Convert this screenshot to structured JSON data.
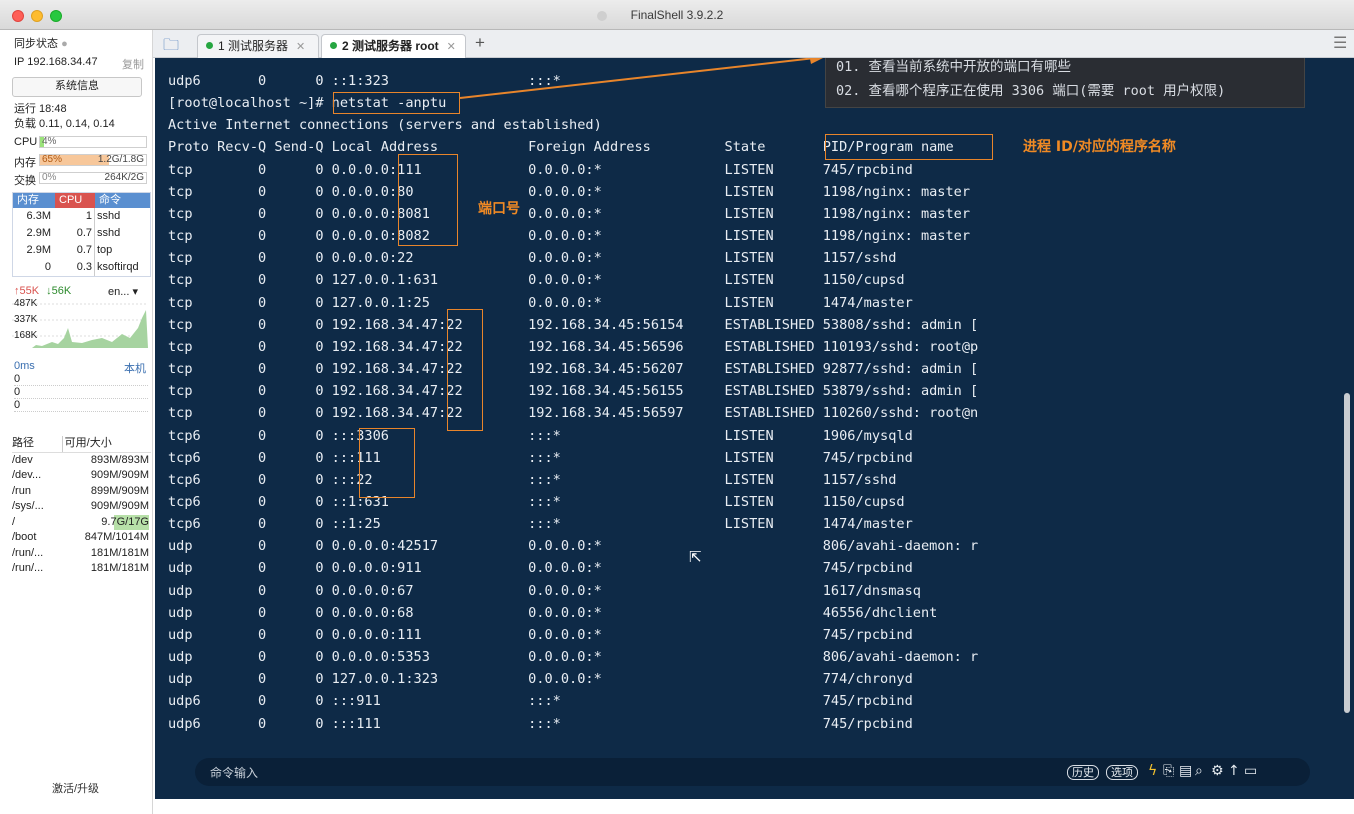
{
  "window": {
    "title": "FinalShell 3.9.2.2"
  },
  "sidebar": {
    "sync_label": "同步状态",
    "ip_label": "IP 192.168.34.47",
    "copy_label": "复制",
    "sysinfo_button": "系统信息",
    "uptime": "运行 18:48",
    "load": "负载 0.11, 0.14, 0.14",
    "cpu": {
      "label": "CPU",
      "value": "4%",
      "fraction": 0.04
    },
    "mem": {
      "label": "内存",
      "percent": "65%",
      "value": "1.2G/1.8G",
      "fraction": 0.65
    },
    "swap": {
      "label": "交换",
      "percent": "0%",
      "value": "264K/2G",
      "fraction": 0.0
    },
    "proc_headers": [
      "内存",
      "CPU",
      "命令"
    ],
    "processes": [
      {
        "mem": "6.3M",
        "cpu": "1",
        "cmd": "sshd"
      },
      {
        "mem": "2.9M",
        "cpu": "0.7",
        "cmd": "sshd"
      },
      {
        "mem": "2.9M",
        "cpu": "0.7",
        "cmd": "top"
      },
      {
        "mem": "0",
        "cpu": "0.3",
        "cmd": "ksoftirqd"
      }
    ],
    "net": {
      "up": "55K",
      "down": "56K",
      "iface": "en...",
      "y_labels": [
        "487K",
        "337K",
        "168K"
      ]
    },
    "latency": {
      "label": "0ms",
      "host": "本机",
      "values": [
        "0",
        "0",
        "0"
      ]
    },
    "disk_headers": [
      "路径",
      "可用/大小"
    ],
    "disks": [
      {
        "path": "/dev",
        "size": "893M/893M"
      },
      {
        "path": "/dev...",
        "size": "909M/909M"
      },
      {
        "path": "/run",
        "size": "899M/909M"
      },
      {
        "path": "/sys/...",
        "size": "909M/909M"
      },
      {
        "path": "/",
        "size": "9.7G/17G"
      },
      {
        "path": "/boot",
        "size": "847M/1014M"
      },
      {
        "path": "/run/...",
        "size": "181M/181M"
      },
      {
        "path": "/run/...",
        "size": "181M/181M"
      }
    ],
    "activate": "激活/升级"
  },
  "tabs": [
    {
      "label": "1 测试服务器",
      "active": false
    },
    {
      "label": "2 测试服务器 root",
      "active": true
    }
  ],
  "terminal": {
    "lines": [
      "udp6       0      0 ::1:323                 :::*",
      "[root@localhost ~]# netstat -anptu",
      "Active Internet connections (servers and established)",
      "Proto Recv-Q Send-Q Local Address           Foreign Address         State       PID/Program name",
      "tcp        0      0 0.0.0.0:111             0.0.0.0:*               LISTEN      745/rpcbind",
      "tcp        0      0 0.0.0.0:80              0.0.0.0:*               LISTEN      1198/nginx: master",
      "tcp        0      0 0.0.0.0:8081            0.0.0.0:*               LISTEN      1198/nginx: master",
      "tcp        0      0 0.0.0.0:8082            0.0.0.0:*               LISTEN      1198/nginx: master",
      "tcp        0      0 0.0.0.0:22              0.0.0.0:*               LISTEN      1157/sshd",
      "tcp        0      0 127.0.0.1:631           0.0.0.0:*               LISTEN      1150/cupsd",
      "tcp        0      0 127.0.0.1:25            0.0.0.0:*               LISTEN      1474/master",
      "tcp        0      0 192.168.34.47:22        192.168.34.45:56154     ESTABLISHED 53808/sshd: admin [",
      "tcp        0      0 192.168.34.47:22        192.168.34.45:56596     ESTABLISHED 110193/sshd: root@p",
      "tcp        0      0 192.168.34.47:22        192.168.34.45:56207     ESTABLISHED 92877/sshd: admin [",
      "tcp        0      0 192.168.34.47:22        192.168.34.45:56155     ESTABLISHED 53879/sshd: admin [",
      "tcp        0      0 192.168.34.47:22        192.168.34.45:56597     ESTABLISHED 110260/sshd: root@n",
      "tcp6       0      0 :::3306                 :::*                    LISTEN      1906/mysqld",
      "tcp6       0      0 :::111                  :::*                    LISTEN      745/rpcbind",
      "tcp6       0      0 :::22                   :::*                    LISTEN      1157/sshd",
      "tcp6       0      0 ::1:631                 :::*                    LISTEN      1150/cupsd",
      "tcp6       0      0 ::1:25                  :::*                    LISTEN      1474/master",
      "udp        0      0 0.0.0.0:42517           0.0.0.0:*                           806/avahi-daemon: r",
      "udp        0      0 0.0.0.0:911             0.0.0.0:*                           745/rpcbind",
      "udp        0      0 0.0.0.0:67              0.0.0.0:*                           1617/dnsmasq",
      "udp        0      0 0.0.0.0:68              0.0.0.0:*                           46556/dhclient",
      "udp        0      0 0.0.0.0:111             0.0.0.0:*                           745/rpcbind",
      "udp        0      0 0.0.0.0:5353            0.0.0.0:*                           806/avahi-daemon: r",
      "udp        0      0 127.0.0.1:323           0.0.0.0:*                           774/chronyd",
      "udp6       0      0 :::911                  :::*                                745/rpcbind",
      "udp6       0      0 :::111                  :::*                                745/rpcbind"
    ]
  },
  "annotations": {
    "note1": "01. 查看当前系统中开放的端口有哪些",
    "note2": "02. 查看哪个程序正在使用 3306 端口(需要 root 用户权限)",
    "port_label": "端口号",
    "pid_label": "进程 ID/对应的程序名称"
  },
  "command_bar": {
    "placeholder": "命令输入",
    "history": "历史",
    "options": "选项"
  },
  "colors": {
    "terminal_bg": "#0e2a47",
    "annotation": "#e8852b",
    "cpu_fill": "#9be37a",
    "mem_fill": "#f7b77a"
  }
}
